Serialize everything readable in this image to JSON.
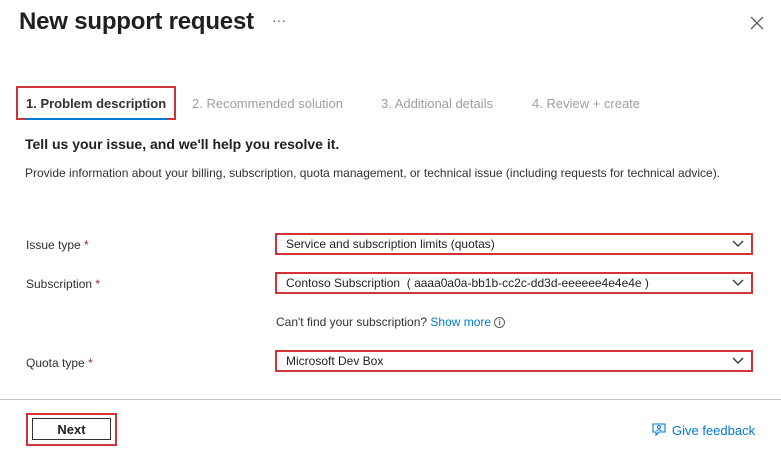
{
  "header": {
    "title": "New support request",
    "more_label": "···"
  },
  "tabs": [
    {
      "label": "1. Problem description",
      "active": true
    },
    {
      "label": "2. Recommended solution",
      "active": false
    },
    {
      "label": "3. Additional details",
      "active": false
    },
    {
      "label": "4. Review + create",
      "active": false
    }
  ],
  "main": {
    "heading": "Tell us your issue, and we'll help you resolve it.",
    "description": "Provide information about your billing, subscription, quota management, or technical issue (including requests for technical advice)."
  },
  "form": {
    "issue_type": {
      "label": "Issue type",
      "required_mark": "*",
      "value": "Service and subscription limits (quotas)"
    },
    "subscription": {
      "label": "Subscription",
      "required_mark": "*",
      "value": "Contoso Subscription  ( aaaa0a0a-bb1b-cc2c-dd3d-eeeeee4e4e4e )"
    },
    "help_text": "Can't find your subscription?",
    "help_link": "Show more",
    "info_glyph": "i",
    "quota_type": {
      "label": "Quota type",
      "required_mark": "*",
      "value": "Microsoft Dev Box"
    }
  },
  "footer": {
    "next_label": "Next",
    "feedback_label": "Give feedback"
  },
  "colors": {
    "accent": "#0078d4",
    "highlight": "#d13438",
    "required": "#a4262c"
  },
  "icons": [
    "more-icon",
    "close-icon",
    "chevron-down-icon",
    "info-icon",
    "feedback-icon"
  ]
}
